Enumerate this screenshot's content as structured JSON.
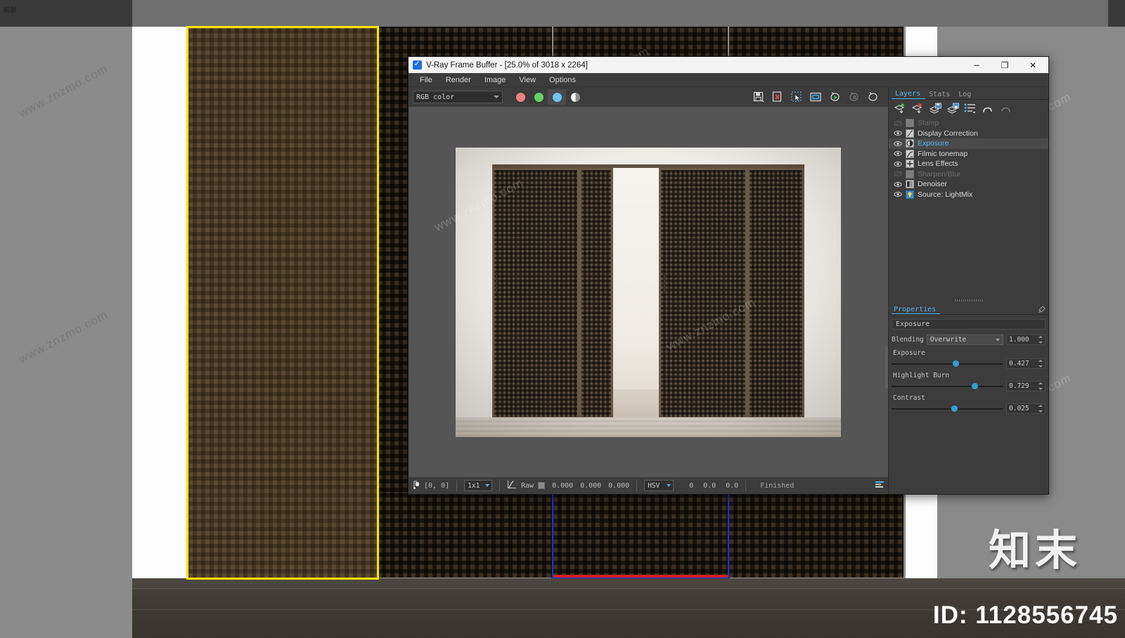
{
  "viewport": {
    "label": "前部",
    "watermarks": [
      "www.znzmo.com",
      "www.znzmo.com",
      "www.znzmo.com",
      "www.znzmo.com",
      "www.znzmo.com",
      "www.znzmo.com"
    ],
    "brand_watermark": "知末",
    "asset_id": "ID: 1128556745"
  },
  "window": {
    "title": "V-Ray Frame Buffer - [25.0% of 3018 x 2264]",
    "icon": "vray-checkbox-icon",
    "controls": {
      "minimize": "−",
      "maximize": "❐",
      "close": "✕"
    }
  },
  "menubar": {
    "items": [
      "File",
      "Render",
      "Image",
      "View",
      "Options"
    ]
  },
  "toolbar": {
    "channel_select": "RGB color",
    "channels": [
      {
        "name": "red-channel-button",
        "color": "#f08080",
        "active": false
      },
      {
        "name": "green-channel-button",
        "color": "#63d463",
        "active": false
      },
      {
        "name": "blue-channel-button",
        "color": "#6ec4f2",
        "active": true
      },
      {
        "name": "alpha-channel-button",
        "color": "#ffffff",
        "active": false
      }
    ],
    "buttons": [
      {
        "name": "save-image-button",
        "label": "Save image",
        "enabled": true
      },
      {
        "name": "save-all-channels-button",
        "label": "Save all channels",
        "enabled": true
      },
      {
        "name": "region-select-button",
        "label": "Select region",
        "enabled": true
      },
      {
        "name": "region-render-button",
        "label": "Render region",
        "enabled": true
      },
      {
        "name": "start-render-button",
        "label": "Start render",
        "enabled": true
      },
      {
        "name": "stop-render-button",
        "label": "Stop render",
        "enabled": false
      },
      {
        "name": "render-last-button",
        "label": "Re-render",
        "enabled": true
      }
    ]
  },
  "statusbar": {
    "pixel_coords": "[0, 0]",
    "sample_size": "1x1",
    "curve_mode": "Raw",
    "rgb": [
      "0.000",
      "0.000",
      "0.000"
    ],
    "color_space": "HSV",
    "hsv": [
      "0",
      "0.0",
      "0.0"
    ],
    "status": "Finished"
  },
  "dock": {
    "tabs": [
      {
        "label": "Layers",
        "active": true
      },
      {
        "label": "Stats",
        "active": false
      },
      {
        "label": "Log",
        "active": false
      }
    ],
    "layer_toolbar": [
      {
        "name": "add-layer-button",
        "label": "Add layer",
        "enabled": true
      },
      {
        "name": "remove-layer-button",
        "label": "Remove layer",
        "enabled": true
      },
      {
        "name": "load-preset-button",
        "label": "Load preset",
        "enabled": true
      },
      {
        "name": "save-preset-button",
        "label": "Save preset",
        "enabled": true
      },
      {
        "name": "layer-menu-button",
        "label": "Layer menu",
        "enabled": true
      },
      {
        "name": "undo-button",
        "label": "Undo",
        "enabled": true
      },
      {
        "name": "redo-button",
        "label": "Redo",
        "enabled": false
      }
    ],
    "layers": [
      {
        "label": "Stamp",
        "icon": "stamp-icon",
        "visible": false,
        "enabled": false,
        "selected": false
      },
      {
        "label": "Display Correction",
        "icon": "curve-icon",
        "visible": true,
        "enabled": true,
        "selected": false
      },
      {
        "label": "Exposure",
        "icon": "exposure-icon",
        "visible": true,
        "enabled": true,
        "selected": true
      },
      {
        "label": "Filmic tonemap",
        "icon": "filmic-icon",
        "visible": true,
        "enabled": true,
        "selected": false
      },
      {
        "label": "Lens Effects",
        "icon": "lens-icon",
        "visible": true,
        "enabled": true,
        "selected": false
      },
      {
        "label": "Sharpen/Blur",
        "icon": "sharpen-icon",
        "visible": false,
        "enabled": false,
        "selected": false
      },
      {
        "label": "Denoiser",
        "icon": "denoiser-icon",
        "visible": true,
        "enabled": true,
        "selected": false
      },
      {
        "label": "Source: LightMix",
        "icon": "lightmix-icon",
        "visible": true,
        "enabled": true,
        "selected": false
      }
    ]
  },
  "properties": {
    "title": "Properties",
    "layer_name": "Exposure",
    "blending": {
      "label": "Blending",
      "value": "Overwrite",
      "amount": "1.000"
    },
    "sliders": [
      {
        "label": "Exposure",
        "value": "0.427",
        "percent": 55
      },
      {
        "label": "Highlight Burn",
        "value": "0.729",
        "percent": 72
      },
      {
        "label": "Contrast",
        "value": "0.025",
        "percent": 54
      }
    ]
  },
  "colors": {
    "accent": "#57b4e8",
    "slider_knob": "#2f9fd6",
    "selection_yellow": "#ffe400",
    "selection_blue": "#1c2fd6",
    "selection_red": "#cf1f1f",
    "window_bg": "#3c3c3c",
    "canvas_bg": "#555555"
  }
}
